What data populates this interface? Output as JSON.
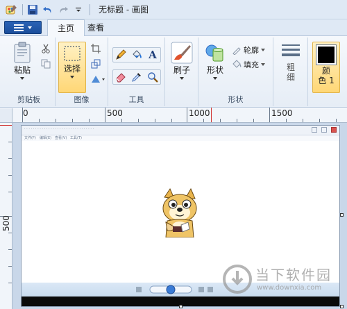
{
  "titlebar": {
    "title": "无标题 - 画图"
  },
  "tabs": [
    {
      "label": "主页"
    },
    {
      "label": "查看"
    }
  ],
  "ribbon": {
    "clipboard": {
      "paste": "粘贴",
      "group": "剪贴板"
    },
    "image": {
      "select": "选择",
      "group": "图像"
    },
    "tools": {
      "group": "工具",
      "text_tool": "A"
    },
    "brushes": {
      "label": "刷子"
    },
    "shapes": {
      "label": "形状",
      "outline": "轮廓",
      "fill": "填充",
      "group": "形状"
    },
    "size": {
      "label_line1": "粗",
      "label_line2": "细"
    },
    "color": {
      "label_line1": "颜",
      "label_line2": "色 1",
      "current": "#000000"
    }
  },
  "ruler": {
    "h_labels": [
      "0",
      "500",
      "1000",
      "1500"
    ],
    "v_labels": [
      "500"
    ]
  },
  "canvas_content": {
    "shot_menu": [
      "文件(F)",
      "编辑(E)",
      "查看(V)",
      "工具(T)"
    ]
  },
  "watermark": {
    "name": "当下软件园",
    "url": "www.downxia.com"
  }
}
